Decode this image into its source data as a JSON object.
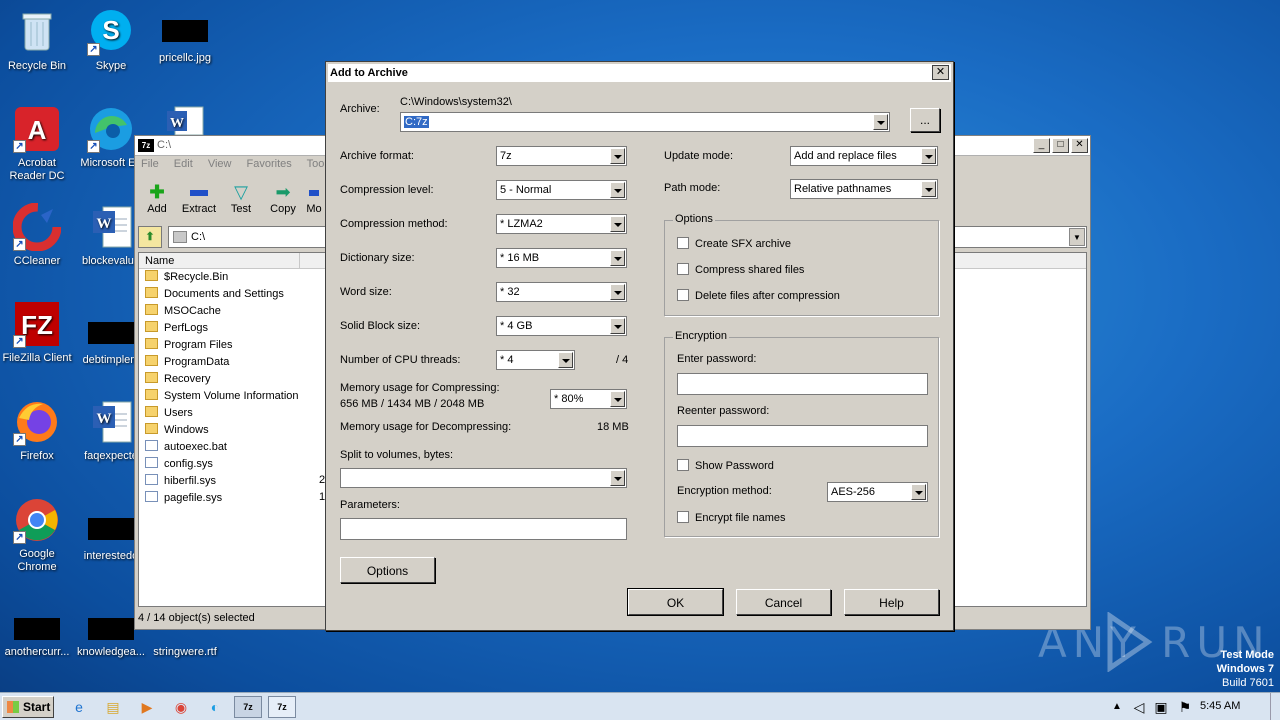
{
  "desktop": {
    "icons": [
      {
        "label": "Recycle Bin",
        "icon": "recycle-bin-icon"
      },
      {
        "label": "Skype",
        "icon": "skype-icon"
      },
      {
        "label": "pricellc.jpg",
        "icon": "image-file-icon"
      },
      {
        "label": "Acrobat Reader DC",
        "icon": "acrobat-icon"
      },
      {
        "label": "Microsoft Ed",
        "icon": "edge-icon"
      },
      {
        "label": "CCleaner",
        "icon": "ccleaner-icon"
      },
      {
        "label": "blockevalua",
        "icon": "word-doc-icon"
      },
      {
        "label": "FileZilla Client",
        "icon": "filezilla-icon"
      },
      {
        "label": "debtimplem",
        "icon": "image-file-icon"
      },
      {
        "label": "Firefox",
        "icon": "firefox-icon"
      },
      {
        "label": "faqexpecte",
        "icon": "word-doc-icon"
      },
      {
        "label": "Google Chrome",
        "icon": "chrome-icon"
      },
      {
        "label": "interestedo",
        "icon": "image-file-icon"
      },
      {
        "label": "anothercurr...",
        "icon": "image-file-icon"
      },
      {
        "label": "knowledgea...",
        "icon": "image-file-icon"
      },
      {
        "label": "stringwere.rtf",
        "icon": "rtf-file-icon"
      }
    ],
    "watermark": "ANY RUN",
    "test_mode": [
      "Test Mode",
      "Windows 7",
      "Build 7601"
    ]
  },
  "file_manager": {
    "title": "C:\\",
    "menu": [
      "File",
      "Edit",
      "View",
      "Favorites",
      "Tools"
    ],
    "toolbar": [
      "Add",
      "Extract",
      "Test",
      "Copy",
      "Mo"
    ],
    "address": "C:\\",
    "column_name": "Name",
    "items": [
      {
        "name": "$Recycle.Bin",
        "type": "folder"
      },
      {
        "name": "Documents and Settings",
        "type": "folder"
      },
      {
        "name": "MSOCache",
        "type": "folder"
      },
      {
        "name": "PerfLogs",
        "type": "folder"
      },
      {
        "name": "Program Files",
        "type": "folder"
      },
      {
        "name": "ProgramData",
        "type": "folder"
      },
      {
        "name": "Recovery",
        "type": "folder"
      },
      {
        "name": "System Volume Information",
        "type": "folder"
      },
      {
        "name": "Users",
        "type": "folder"
      },
      {
        "name": "Windows",
        "type": "folder"
      },
      {
        "name": "autoexec.bat",
        "type": "file"
      },
      {
        "name": "config.sys",
        "type": "file"
      },
      {
        "name": "hiberfil.sys",
        "type": "file",
        "size": "2"
      },
      {
        "name": "pagefile.sys",
        "type": "file",
        "size": "1"
      }
    ],
    "status": "4 / 14 object(s) selected"
  },
  "dialog": {
    "title": "Add to Archive",
    "archive_label": "Archive:",
    "archive_path": "C:\\Windows\\system32\\",
    "archive_name": "C:7z",
    "browse": "...",
    "archive_format_label": "Archive format:",
    "archive_format": "7z",
    "compression_level_label": "Compression level:",
    "compression_level": "5 - Normal",
    "compression_method_label": "Compression method:",
    "compression_method": "*  LZMA2",
    "dictionary_size_label": "Dictionary size:",
    "dictionary_size": "*  16 MB",
    "word_size_label": "Word size:",
    "word_size": "*  32",
    "solid_block_label": "Solid Block size:",
    "solid_block": "*  4 GB",
    "cpu_threads_label": "Number of CPU threads:",
    "cpu_threads": "*  4",
    "cpu_threads_max": "/ 4",
    "mem_compress_label": "Memory usage for Compressing:",
    "mem_compress_values": "656 MB / 1434 MB / 2048 MB",
    "mem_compress_pct": "*  80%",
    "mem_decompress_label": "Memory usage for Decompressing:",
    "mem_decompress": "18 MB",
    "split_label": "Split to volumes, bytes:",
    "split_value": "",
    "parameters_label": "Parameters:",
    "parameters_value": "",
    "options_button": "Options",
    "update_mode_label": "Update mode:",
    "update_mode": "Add and replace files",
    "path_mode_label": "Path mode:",
    "path_mode": "Relative pathnames",
    "options_group": "Options",
    "create_sfx": "Create SFX archive",
    "compress_shared": "Compress shared files",
    "delete_after": "Delete files after compression",
    "encryption_group": "Encryption",
    "enter_password": "Enter password:",
    "reenter_password": "Reenter password:",
    "show_password": "Show Password",
    "encryption_method_label": "Encryption method:",
    "encryption_method": "AES-256",
    "encrypt_names": "Encrypt file names",
    "ok": "OK",
    "cancel": "Cancel",
    "help": "Help"
  },
  "taskbar": {
    "start": "Start",
    "app1": "7z",
    "app2": "7z",
    "clock": "5:45 AM"
  }
}
